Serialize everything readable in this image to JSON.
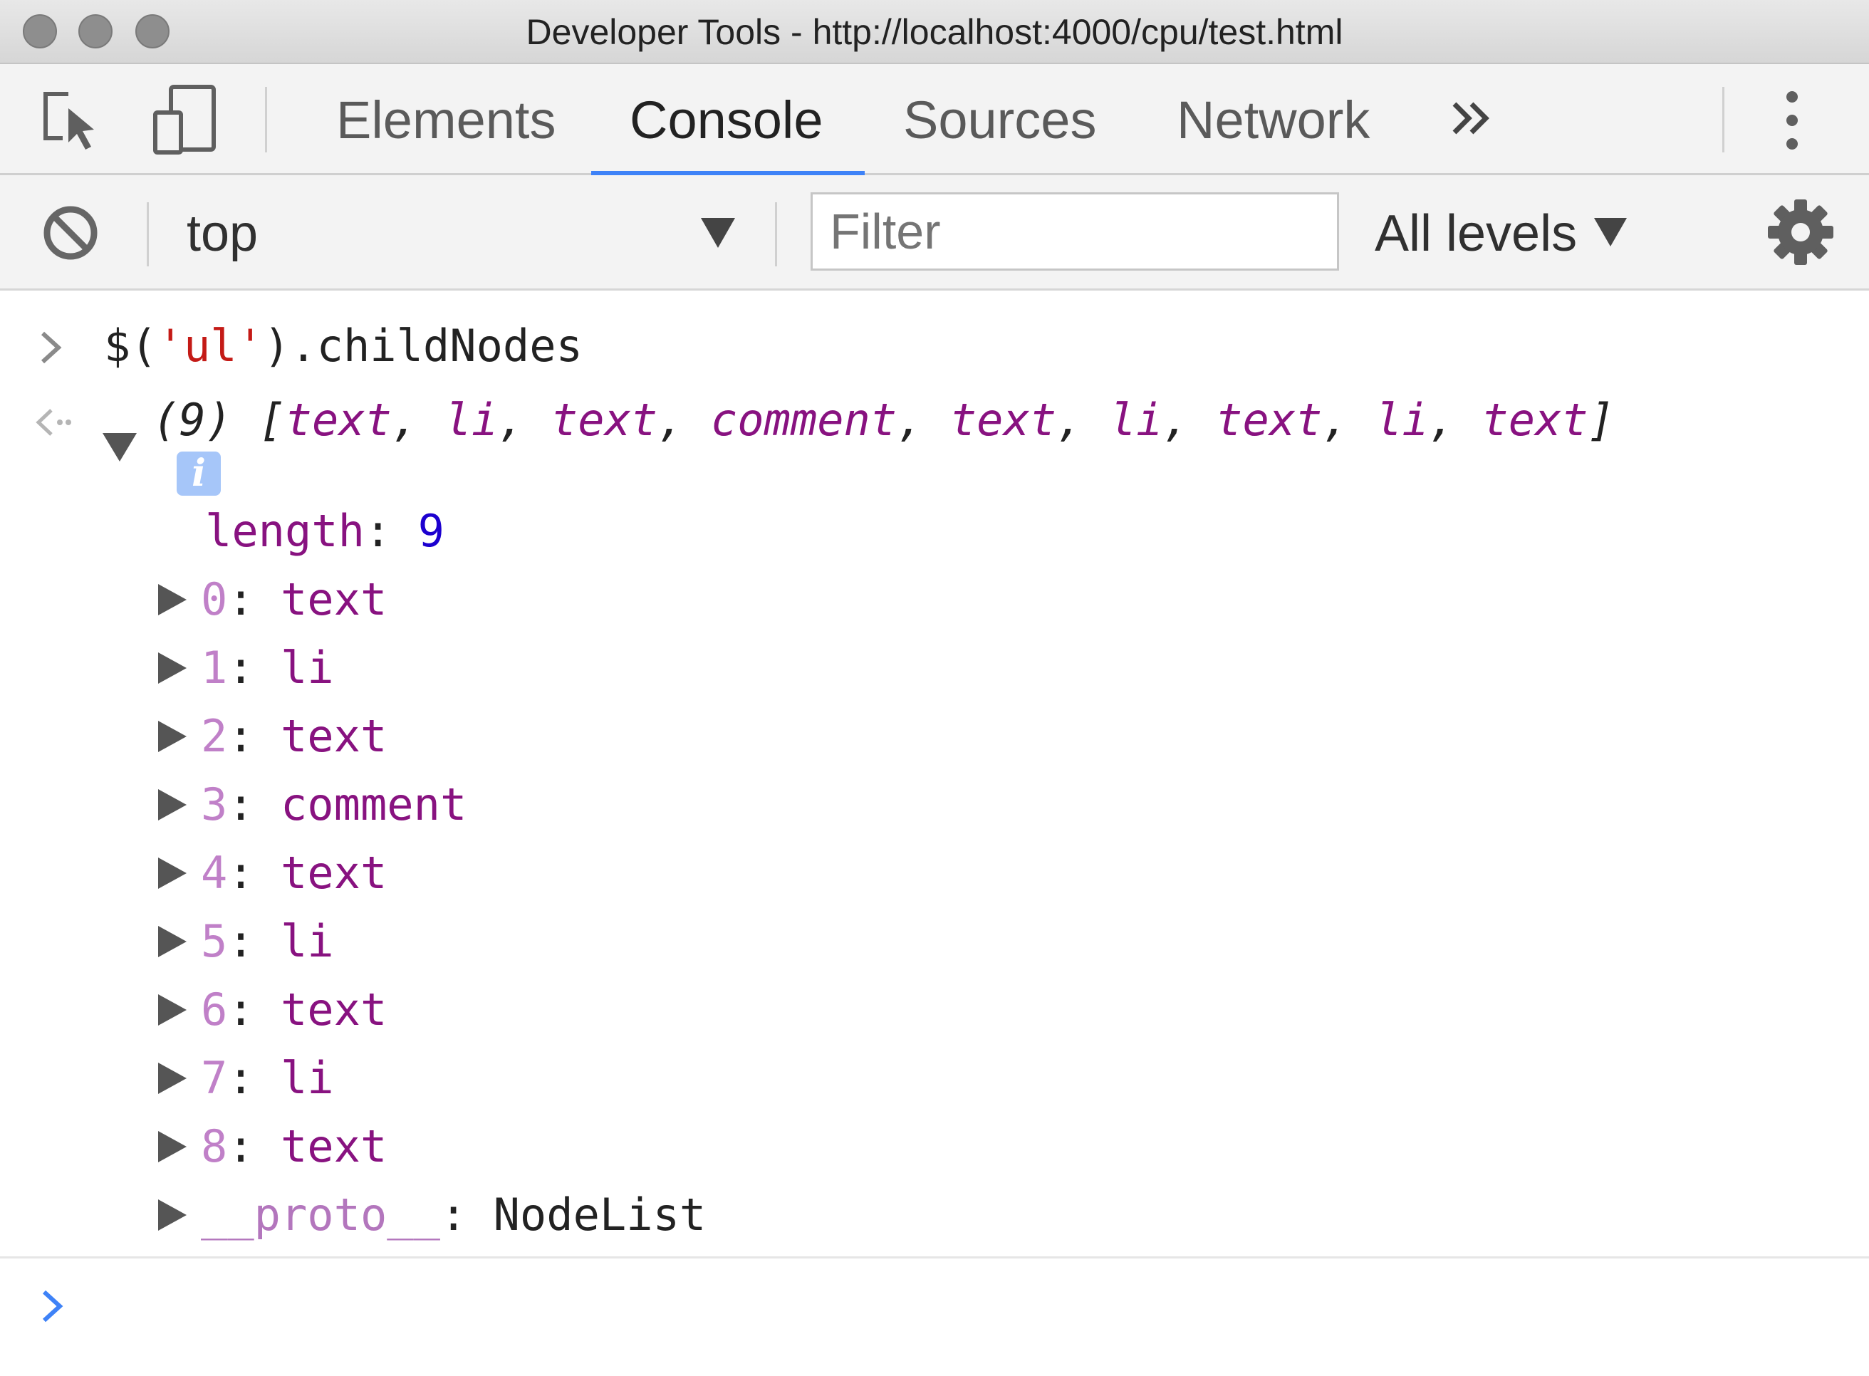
{
  "window": {
    "title": "Developer Tools - http://localhost:4000/cpu/test.html"
  },
  "tabs": {
    "items": [
      "Elements",
      "Console",
      "Sources",
      "Network"
    ],
    "active": "Console",
    "more_icon": "double-chevron-right-icon"
  },
  "toolbar": {
    "context": "top",
    "filter_placeholder": "Filter",
    "filter_value": "",
    "levels": "All levels"
  },
  "console": {
    "command": {
      "prefix": "$(",
      "string": "'ul'",
      "suffix": ").childNodes"
    },
    "result": {
      "count": "(9)",
      "summary_items": [
        "text",
        "li",
        "text",
        "comment",
        "text",
        "li",
        "text",
        "li",
        "text"
      ],
      "info_badge": "i",
      "length_key": "length",
      "length_value": "9",
      "nodes": [
        {
          "index": "0",
          "value": "text"
        },
        {
          "index": "1",
          "value": "li"
        },
        {
          "index": "2",
          "value": "text"
        },
        {
          "index": "3",
          "value": "comment"
        },
        {
          "index": "4",
          "value": "text"
        },
        {
          "index": "5",
          "value": "li"
        },
        {
          "index": "6",
          "value": "text"
        },
        {
          "index": "7",
          "value": "li"
        },
        {
          "index": "8",
          "value": "text"
        }
      ],
      "proto_key": "__proto__",
      "proto_value": "NodeList"
    }
  },
  "colors": {
    "accent": "#3e82f7",
    "tag_purple": "#881280",
    "string_red": "#c41a16",
    "number_blue": "#1c00cf"
  }
}
